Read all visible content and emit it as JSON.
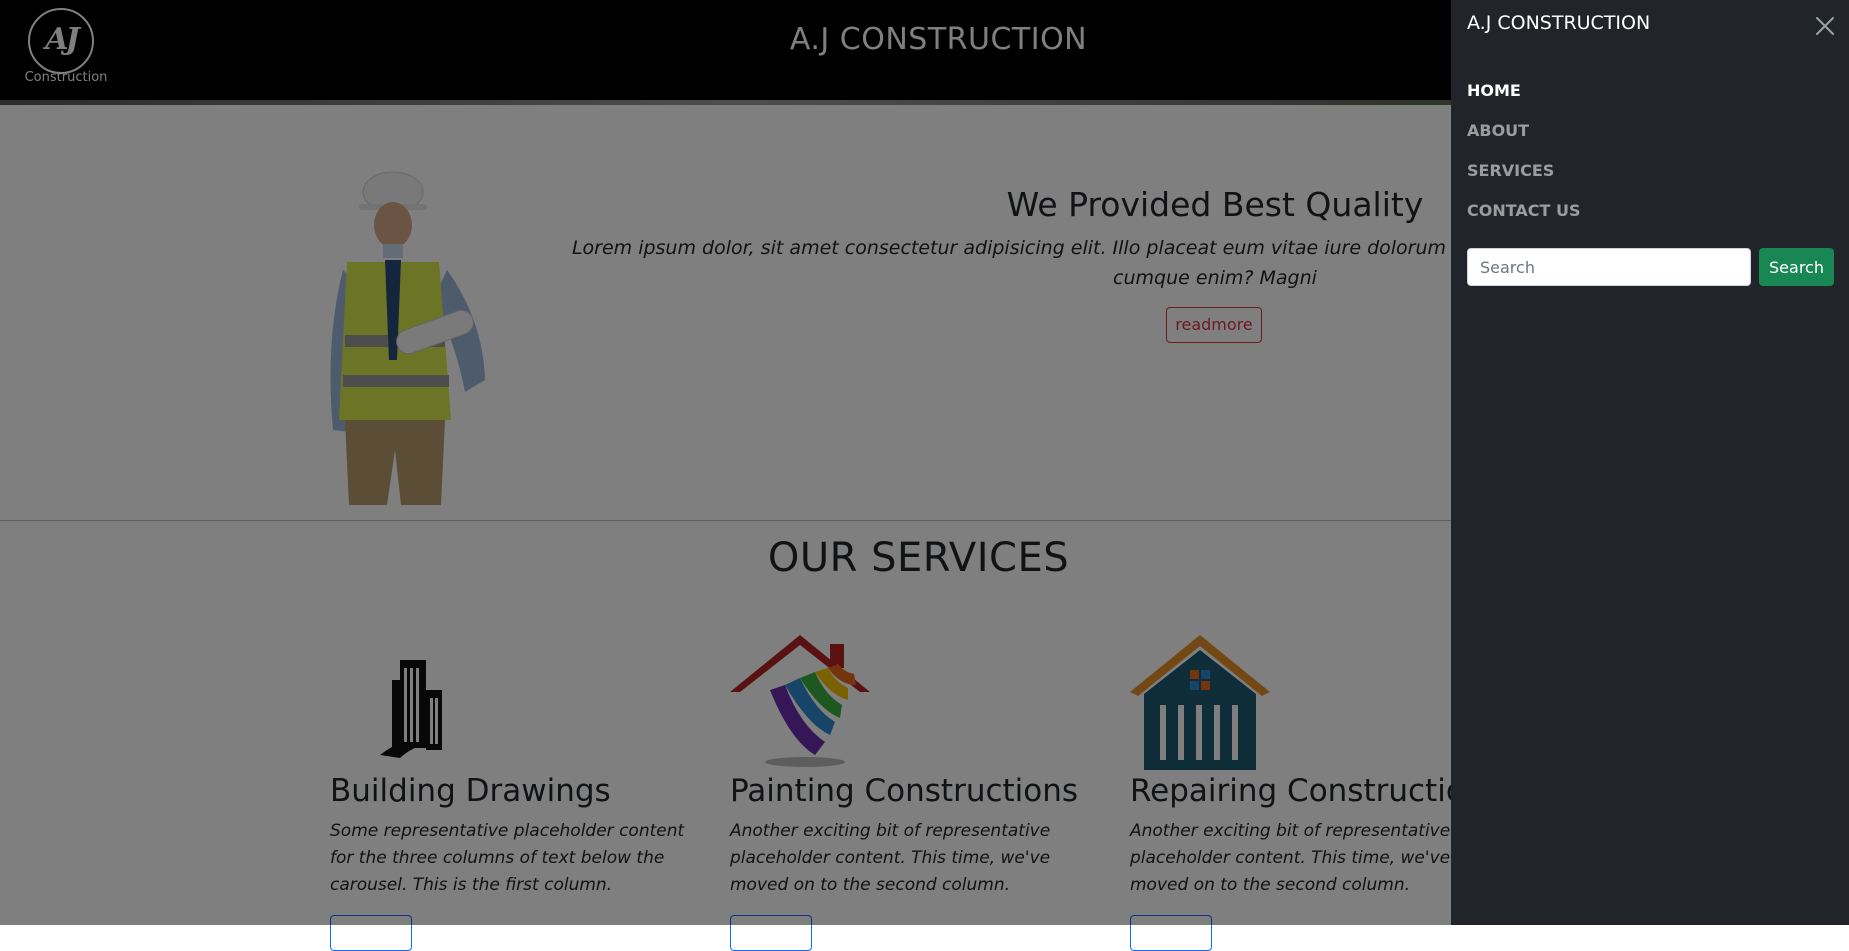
{
  "header": {
    "logo_monogram": "AJ",
    "logo_subtitle": "Construction",
    "site_title": "A.J CONSTRUCTION"
  },
  "hero": {
    "title": "We Provided Best Quality",
    "text": "Lorem ipsum dolor, sit amet consectetur adipisicing elit. Illo placeat eum vitae iure dolorum aliquid facere, aperiam ipsum quos a illum cumque enim? Magni",
    "button_label": "readmore"
  },
  "services": {
    "title": "OUR SERVICES",
    "items": [
      {
        "heading": "Building Drawings",
        "text": "Some representative placeholder content for the three columns of text below the carousel. This is the first column.",
        "icon": "building-icon"
      },
      {
        "heading": "Painting Constructions",
        "text": "Another exciting bit of representative placeholder content. This time, we've moved on to the second column.",
        "icon": "paint-house-icon"
      },
      {
        "heading": "Repairing Constructions",
        "text": "Another exciting bit of representative placeholder content. This time, we've moved on to the second column.",
        "icon": "repair-house-icon"
      }
    ]
  },
  "offcanvas": {
    "title": "A.J CONSTRUCTION",
    "nav": [
      {
        "label": "HOME",
        "active": true
      },
      {
        "label": "ABOUT",
        "active": false
      },
      {
        "label": "SERVICES",
        "active": false
      },
      {
        "label": "CONTACT US",
        "active": false
      }
    ],
    "search_placeholder": "Search",
    "search_button": "Search",
    "close_icon": "close-icon"
  },
  "colors": {
    "offcanvas_bg": "#212529",
    "search_button": "#198754",
    "readmore_border": "#dc3545",
    "service_button_border": "#0d6efd"
  }
}
